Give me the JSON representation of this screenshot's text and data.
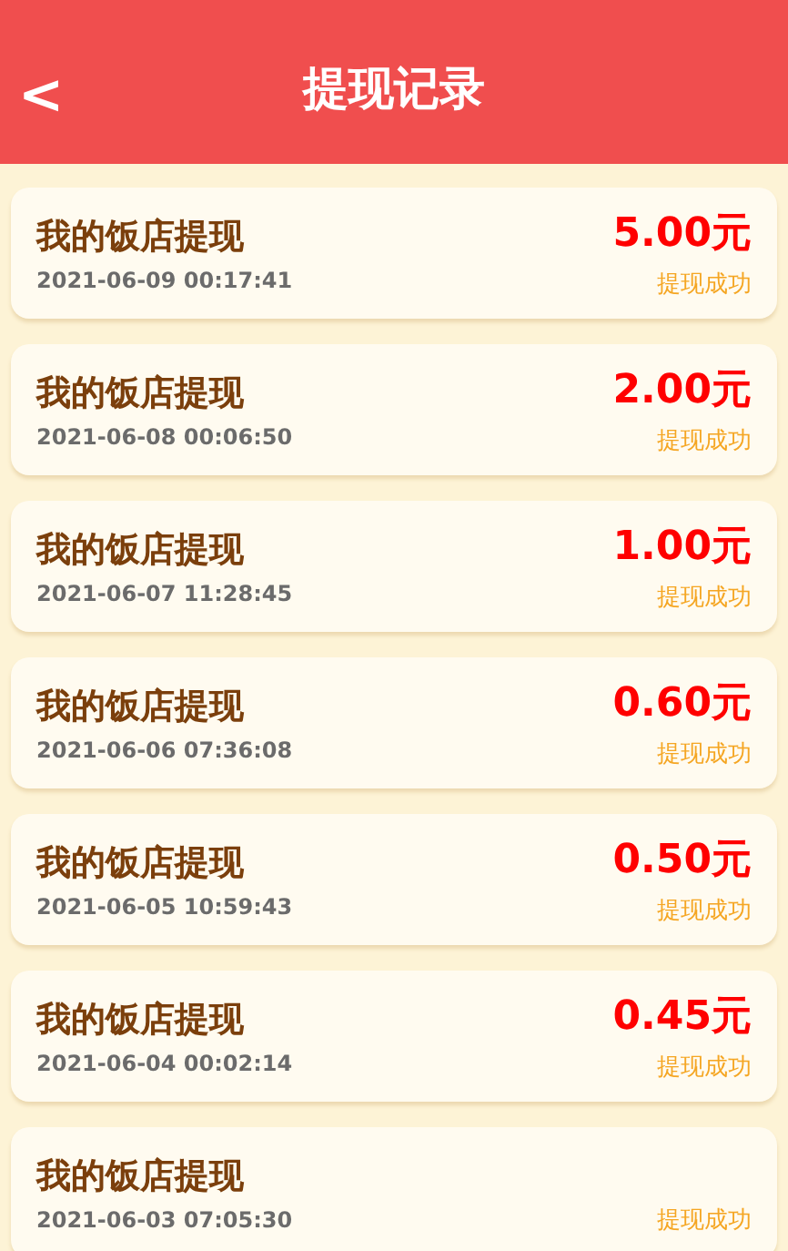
{
  "header": {
    "back_icon": "<",
    "title": "提现记录"
  },
  "records": [
    {
      "title": "我的饭店提现",
      "time": "2021-06-09  00:17:41",
      "amount": "5.00元",
      "status": "提现成功"
    },
    {
      "title": "我的饭店提现",
      "time": "2021-06-08  00:06:50",
      "amount": "2.00元",
      "status": "提现成功"
    },
    {
      "title": "我的饭店提现",
      "time": "2021-06-07  11:28:45",
      "amount": "1.00元",
      "status": "提现成功"
    },
    {
      "title": "我的饭店提现",
      "time": "2021-06-06  07:36:08",
      "amount": "0.60元",
      "status": "提现成功"
    },
    {
      "title": "我的饭店提现",
      "time": "2021-06-05  10:59:43",
      "amount": "0.50元",
      "status": "提现成功"
    },
    {
      "title": "我的饭店提现",
      "time": "2021-06-04  00:02:14",
      "amount": "0.45元",
      "status": "提现成功"
    },
    {
      "title": "我的饭店提现",
      "time": "2021-06-03  07:05:30",
      "status": "提现成功"
    }
  ]
}
